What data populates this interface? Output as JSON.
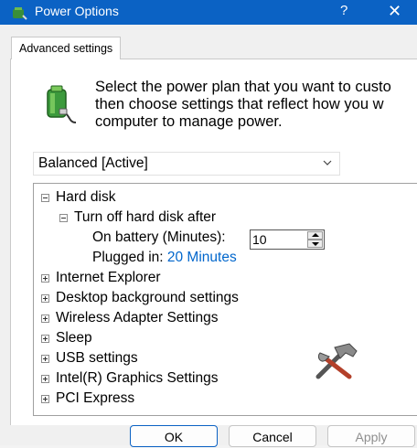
{
  "window": {
    "title": "Power Options",
    "help_label": "?",
    "close_label": "✕"
  },
  "tab": {
    "label": "Advanced settings"
  },
  "description": {
    "line1": "Select the power plan that you want to custo",
    "line2": "then choose settings that reflect how you w",
    "line3": "computer to manage power."
  },
  "plan": {
    "selected": "Balanced [Active]"
  },
  "tree": {
    "hard_disk": "Hard disk",
    "turn_off_after": "Turn off hard disk after",
    "on_battery_label": "On battery (Minutes):",
    "on_battery_value": "10",
    "plugged_in_label": "Plugged in:",
    "plugged_in_value": "20 Minutes",
    "items": [
      "Internet Explorer",
      "Desktop background settings",
      "Wireless Adapter Settings",
      "Sleep",
      "USB settings",
      "Intel(R) Graphics Settings",
      "PCI Express"
    ]
  },
  "buttons": {
    "ok": "OK",
    "cancel": "Cancel",
    "apply": "Apply"
  },
  "colors": {
    "titlebar": "#0b62c4",
    "link": "#0066cc"
  }
}
